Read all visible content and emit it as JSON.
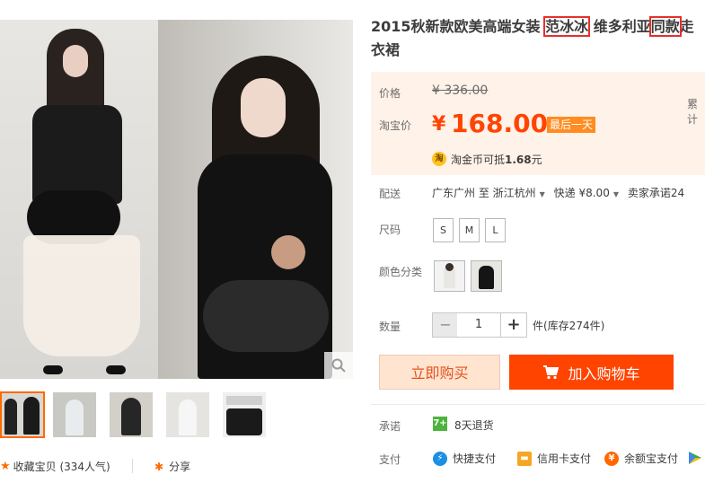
{
  "product": {
    "title_pre": "2015秋新款欧美高端女装 ",
    "title_hl1": "范冰冰",
    "title_mid": " 维多利亚",
    "title_hl2": "同款",
    "title_post": "走",
    "title_line2": "衣裙"
  },
  "price": {
    "label": "价格",
    "original": "¥ 336.00",
    "cumulative_label": "累计",
    "taobao_label": "淘宝价",
    "currency": "¥",
    "current": "168.00",
    "badge": "最后一天",
    "coin_icon": "淘",
    "coin_text_pre": "淘金币可抵",
    "coin_amount": "1.68",
    "coin_text_post": "元"
  },
  "shipping": {
    "label": "配送",
    "from": "广东广州 至",
    "to": "浙江杭州",
    "express": "快递 ¥8.00",
    "promise": "卖家承诺24"
  },
  "size": {
    "label": "尺码",
    "options": [
      "S",
      "M",
      "L"
    ]
  },
  "color": {
    "label": "颜色分类"
  },
  "quantity": {
    "label": "数量",
    "minus": "−",
    "value": "1",
    "plus": "+",
    "stock": "件(库存274件)"
  },
  "actions": {
    "buy_now": "立即购买",
    "add_cart": "加入购物车"
  },
  "commitment": {
    "label": "承诺",
    "icon": "7+",
    "text": "8天退货"
  },
  "payment": {
    "label": "支付",
    "methods": [
      "快捷支付",
      "信用卡支付",
      "余额宝支付"
    ]
  },
  "social": {
    "favorite": "收藏宝贝 (334人气)",
    "share": "分享"
  },
  "colors": {
    "accent": "#ff4400",
    "badge": "#ff8c20",
    "highlight_border": "#e4302c"
  }
}
